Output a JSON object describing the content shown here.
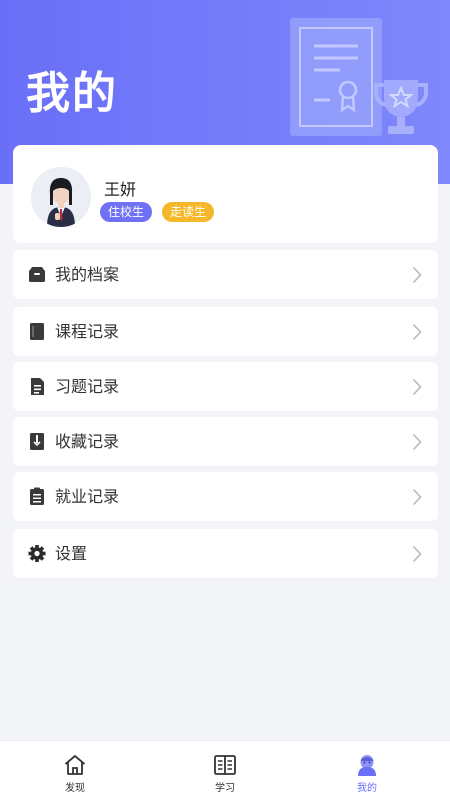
{
  "header": {
    "title": "我的"
  },
  "profile": {
    "name": "王妍",
    "badges": [
      "住校生",
      "走读生"
    ]
  },
  "menu": [
    {
      "label": "我的档案",
      "icon": "archive-box-icon"
    },
    {
      "label": "课程记录",
      "icon": "book-icon"
    },
    {
      "label": "习题记录",
      "icon": "document-list-icon"
    },
    {
      "label": "收藏记录",
      "icon": "bookmark-icon"
    },
    {
      "label": "就业记录",
      "icon": "clipboard-icon"
    },
    {
      "label": "设置",
      "icon": "gear-icon"
    }
  ],
  "tabbar": [
    {
      "label": "发现",
      "icon": "home-icon",
      "active": false
    },
    {
      "label": "学习",
      "icon": "open-book-icon",
      "active": false
    },
    {
      "label": "我的",
      "icon": "profile-icon",
      "active": true
    }
  ],
  "colors": {
    "accent": "#6a6ff8",
    "badge_boarding": "#6f72f5",
    "badge_day": "#f5b82b",
    "background": "#f3f4f8"
  }
}
